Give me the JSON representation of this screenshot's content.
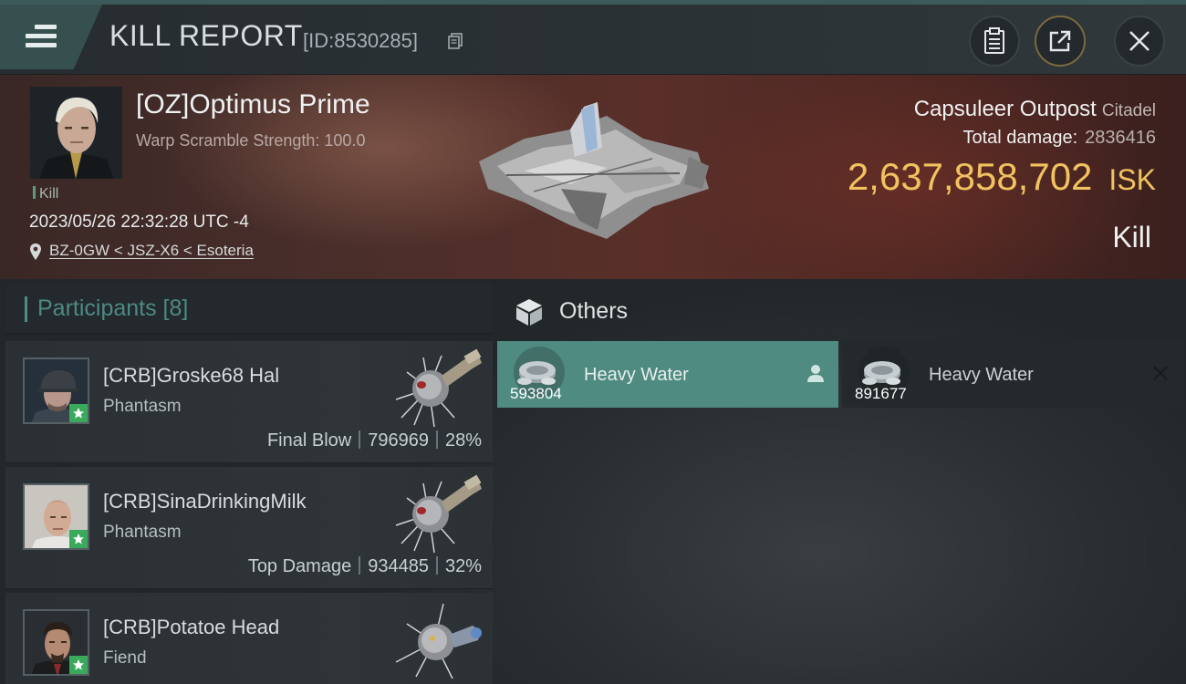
{
  "header": {
    "title": "KILL REPORT",
    "report_id": "[ID:8530285]",
    "buttons": {
      "copy": "clipboard-icon",
      "share": "share-icon",
      "close": "close-icon"
    }
  },
  "victim": {
    "name": "[OZ]Optimus Prime",
    "subtitle": "Warp Scramble Strength: 100.0",
    "tag": "Kill",
    "datetime": "2023/05/26 22:32:28 UTC -4",
    "location": "BZ-0GW < JSZ-X6 < Esoteria"
  },
  "target": {
    "name": "Capsuleer Outpost",
    "class": "Citadel",
    "total_damage_label": "Total damage:",
    "total_damage": "2836416",
    "isk_value": "2,637,858,702",
    "isk_unit": "ISK",
    "status": "Kill"
  },
  "participants": {
    "label": "Participants [8]",
    "items": [
      {
        "name": "[CRB]Groske68 Hal",
        "ship": "Phantasm",
        "role": "Final Blow",
        "damage": "796969",
        "percent": "28%"
      },
      {
        "name": "[CRB]SinaDrinkingMilk",
        "ship": "Phantasm",
        "role": "Top Damage",
        "damage": "934485",
        "percent": "32%"
      },
      {
        "name": "[CRB]Potatoe Head",
        "ship": "Fiend",
        "role": "",
        "damage": "",
        "percent": ""
      }
    ]
  },
  "others": {
    "label": "Others",
    "items": [
      {
        "name": "Heavy Water",
        "quantity": "593804",
        "selected": true
      },
      {
        "name": "Heavy Water",
        "quantity": "891677",
        "selected": false
      }
    ]
  },
  "colors": {
    "accent_teal": "#4f8b80",
    "isk_gold": "#f1c25f",
    "banner_red": "#5a2f29",
    "star_green": "#3aa95b"
  }
}
